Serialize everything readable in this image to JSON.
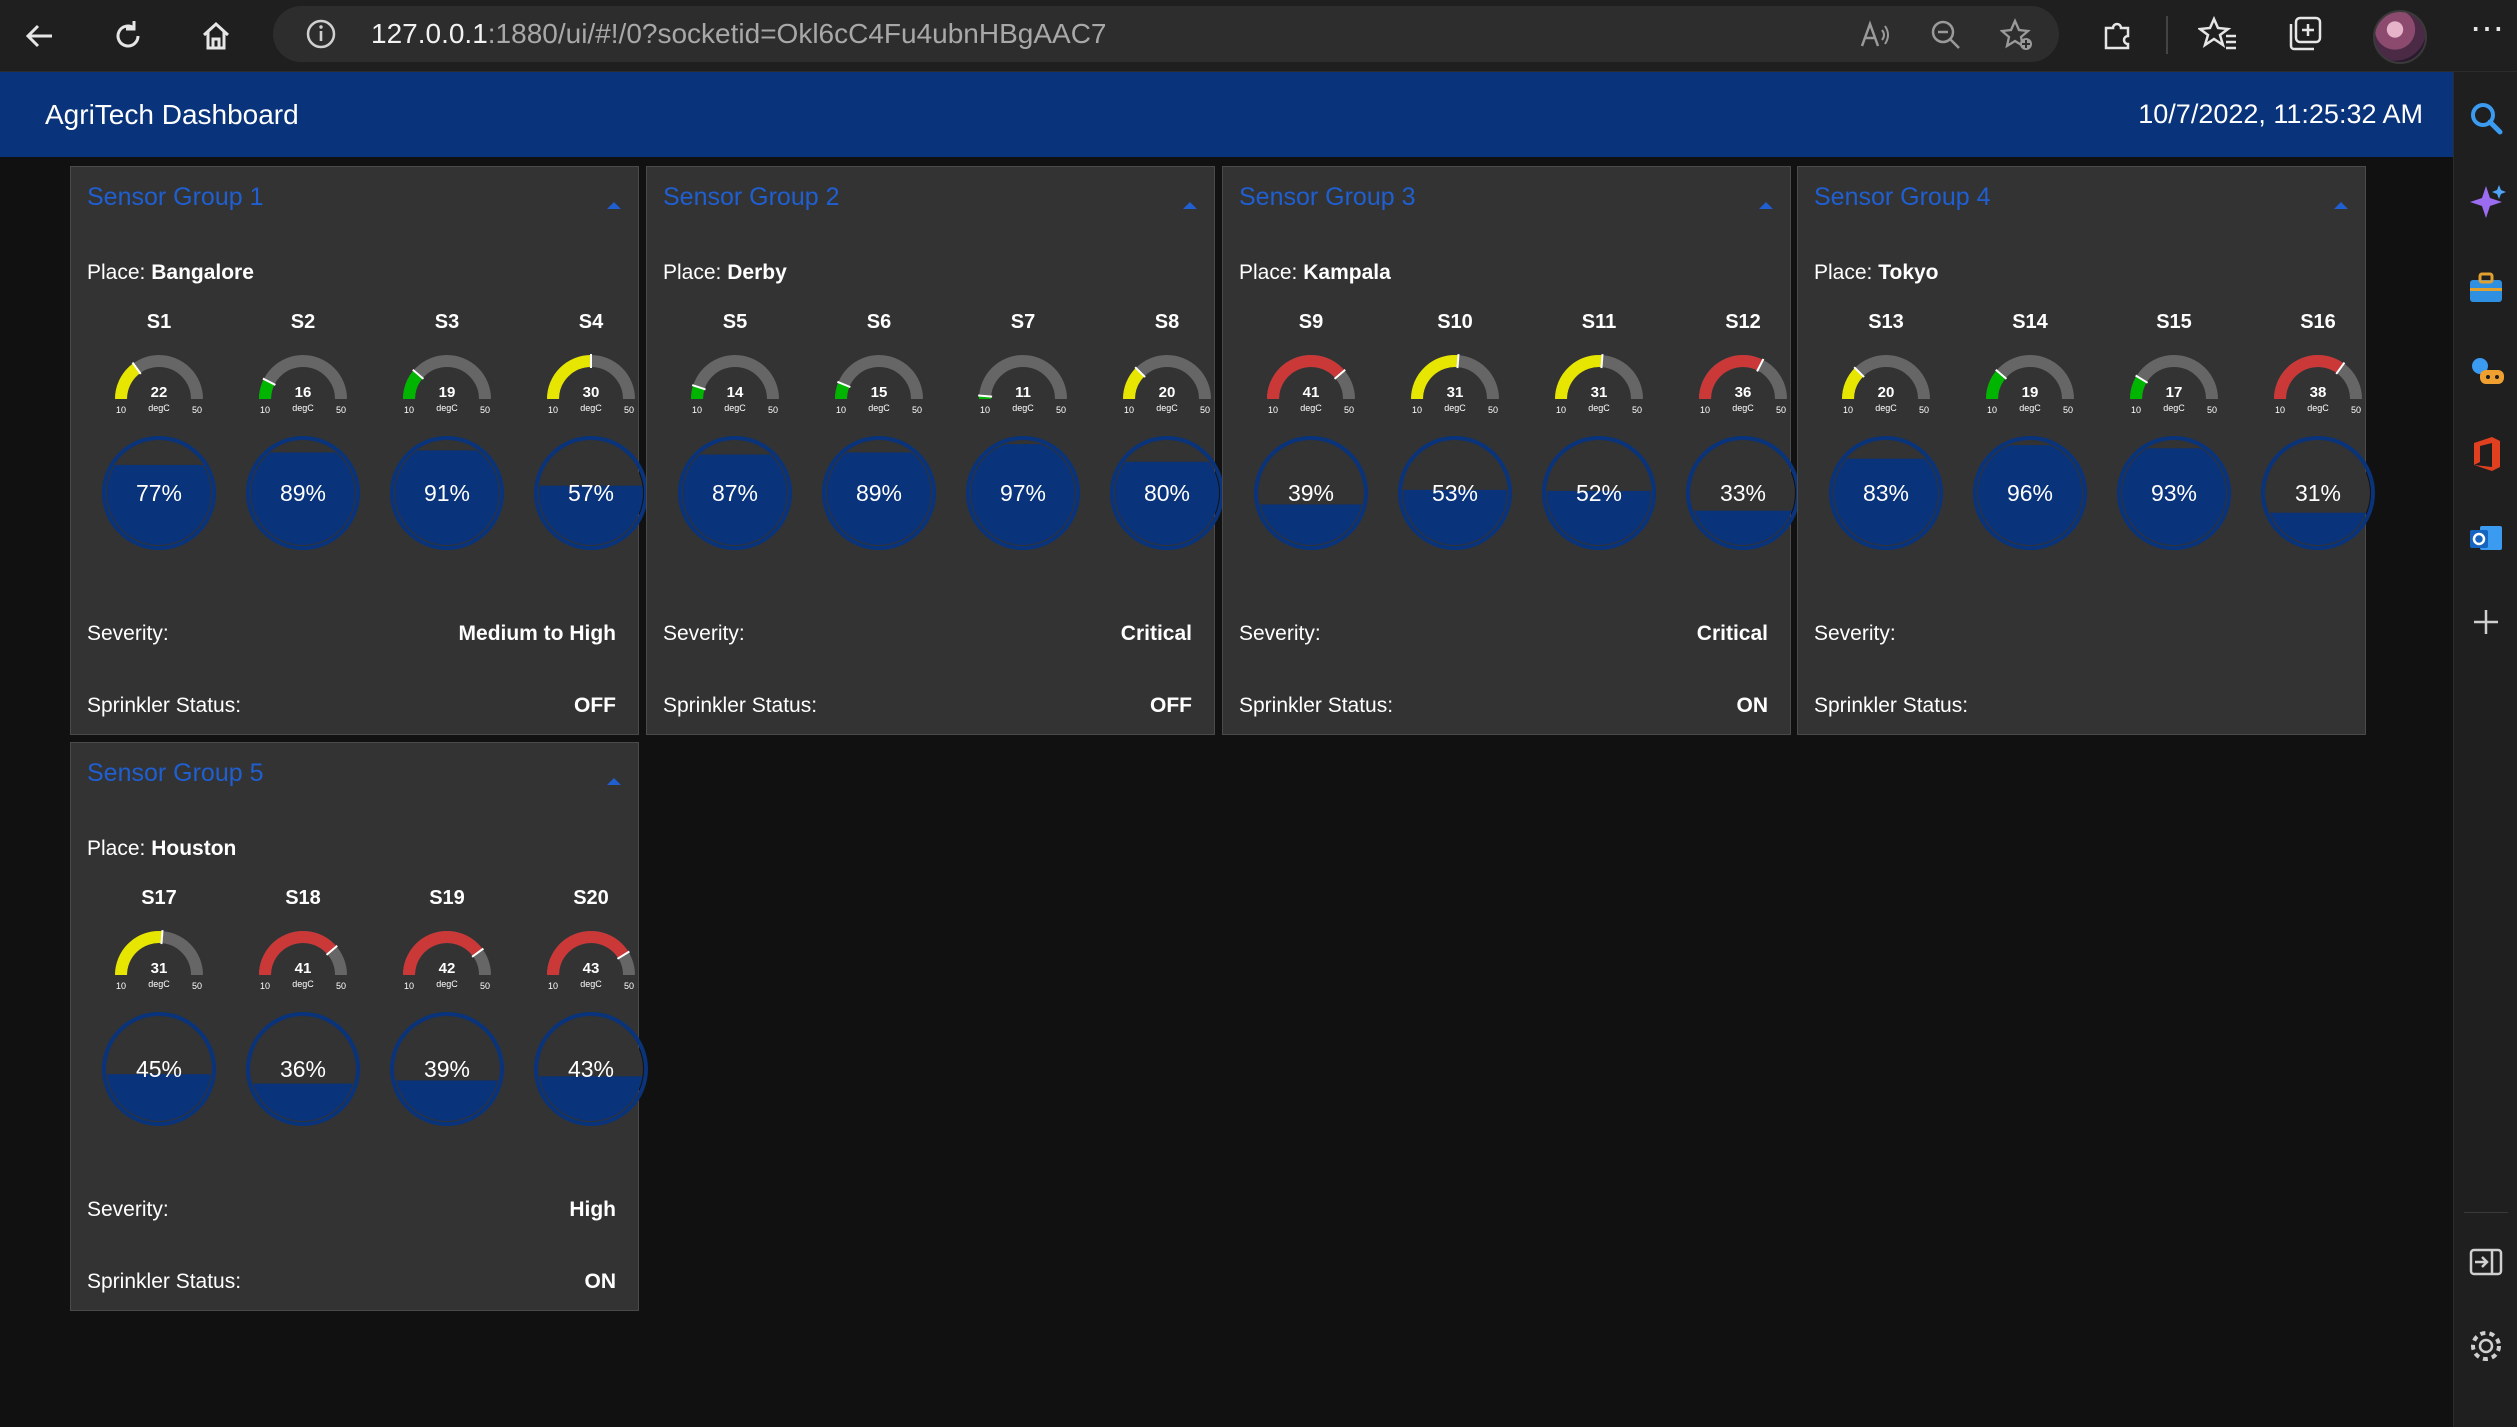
{
  "browser": {
    "url_host": "127.0.0.1",
    "url_rest": ":1880/ui/#!/0?socketid=Okl6cC4Fu4ubnHBgAAC7"
  },
  "header": {
    "title": "AgriTech Dashboard",
    "clock": "10/7/2022, 11:25:32 AM"
  },
  "labels": {
    "place": "Place:",
    "severity": "Severity:",
    "sprinkler": "Sprinkler Status:",
    "unit": "degC",
    "gauge_min": "10",
    "gauge_max": "50"
  },
  "colors": {
    "header_bg": "#09337a",
    "card_bg": "#333333",
    "gauge_green": "#00b500",
    "gauge_yellow": "#e6e600",
    "gauge_red": "#ca3838",
    "gauge_track": "#666666",
    "tank_fill": "#09337a",
    "tank_empty": "#333333",
    "title_blue": "#1f5fd1"
  },
  "groups": [
    {
      "title": "Sensor Group 1",
      "place": "Bangalore",
      "severity": "Medium to High",
      "sprinkler": "OFF",
      "sensors": [
        {
          "name": "S1",
          "temp": 22,
          "moisture": 77
        },
        {
          "name": "S2",
          "temp": 16,
          "moisture": 89
        },
        {
          "name": "S3",
          "temp": 19,
          "moisture": 91
        },
        {
          "name": "S4",
          "temp": 30,
          "moisture": 57
        }
      ]
    },
    {
      "title": "Sensor Group 2",
      "place": "Derby",
      "severity": "Critical",
      "sprinkler": "OFF",
      "sensors": [
        {
          "name": "S5",
          "temp": 14,
          "moisture": 87
        },
        {
          "name": "S6",
          "temp": 15,
          "moisture": 89
        },
        {
          "name": "S7",
          "temp": 11,
          "moisture": 97
        },
        {
          "name": "S8",
          "temp": 20,
          "moisture": 80
        }
      ]
    },
    {
      "title": "Sensor Group 3",
      "place": "Kampala",
      "severity": "Critical",
      "sprinkler": "ON",
      "sensors": [
        {
          "name": "S9",
          "temp": 41,
          "moisture": 39
        },
        {
          "name": "S10",
          "temp": 31,
          "moisture": 53
        },
        {
          "name": "S11",
          "temp": 31,
          "moisture": 52
        },
        {
          "name": "S12",
          "temp": 36,
          "moisture": 33
        }
      ]
    },
    {
      "title": "Sensor Group 4",
      "place": "Tokyo",
      "severity": "",
      "sprinkler": "",
      "sensors": [
        {
          "name": "S13",
          "temp": 20,
          "moisture": 83
        },
        {
          "name": "S14",
          "temp": 19,
          "moisture": 96
        },
        {
          "name": "S15",
          "temp": 17,
          "moisture": 93
        },
        {
          "name": "S16",
          "temp": 38,
          "moisture": 31
        }
      ]
    },
    {
      "title": "Sensor Group 5",
      "place": "Houston",
      "severity": "High",
      "sprinkler": "ON",
      "sensors": [
        {
          "name": "S17",
          "temp": 31,
          "moisture": 45
        },
        {
          "name": "S18",
          "temp": 41,
          "moisture": 36
        },
        {
          "name": "S19",
          "temp": 42,
          "moisture": 39
        },
        {
          "name": "S20",
          "temp": 43,
          "moisture": 43
        }
      ]
    }
  ]
}
